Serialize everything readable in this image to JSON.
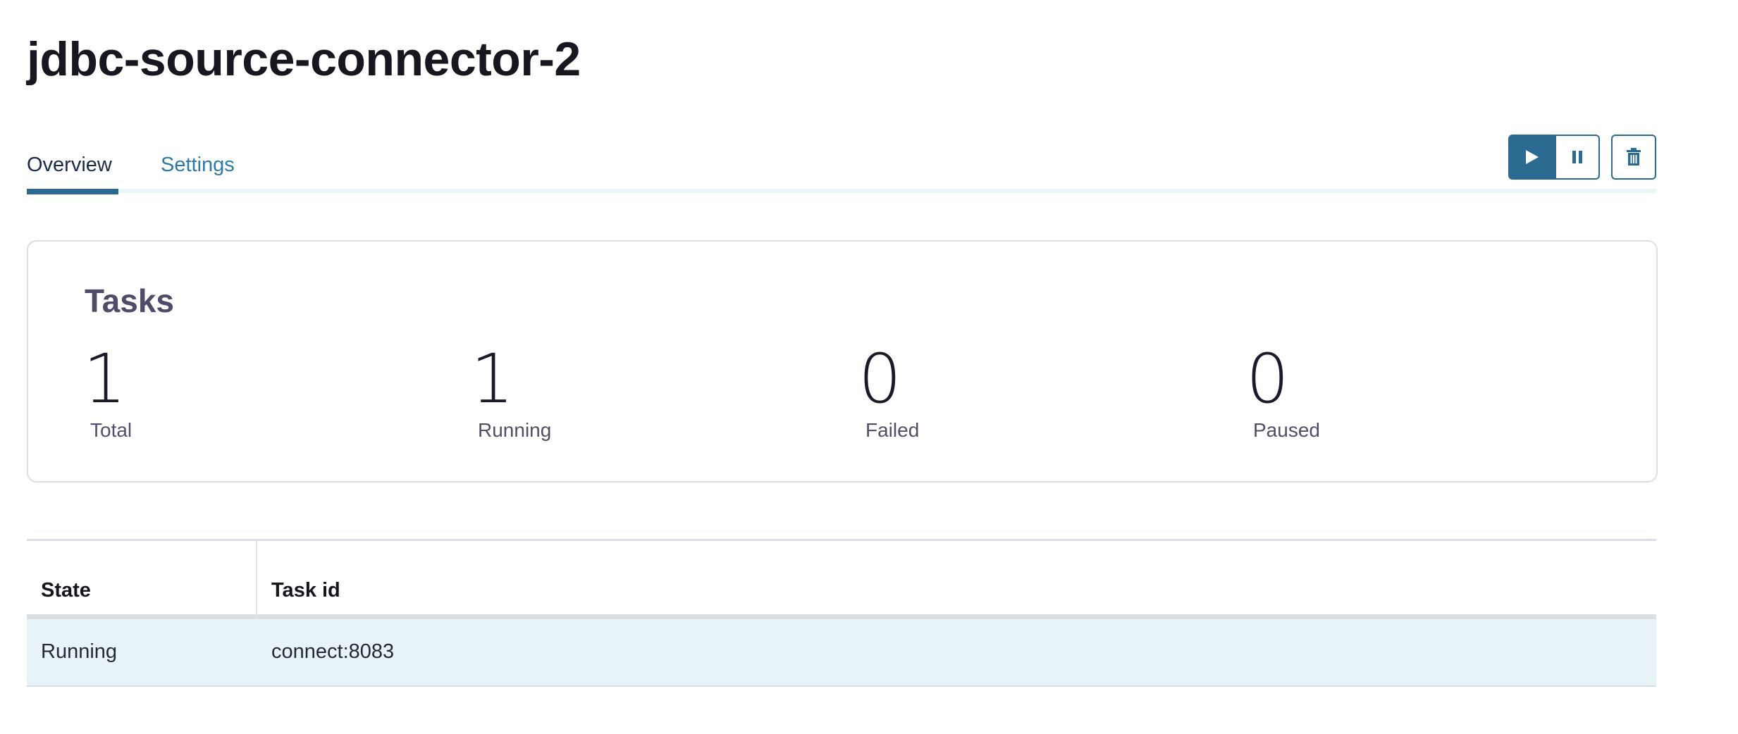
{
  "page": {
    "title": "jdbc-source-connector-2"
  },
  "tabs": [
    {
      "label": "Overview",
      "active": true
    },
    {
      "label": "Settings",
      "active": false
    }
  ],
  "actions": {
    "play_icon": "play-icon",
    "pause_icon": "pause-icon",
    "delete_icon": "trash-icon"
  },
  "tasks": {
    "title": "Tasks",
    "stats": [
      {
        "value": "1",
        "label": "Total"
      },
      {
        "value": "1",
        "label": "Running"
      },
      {
        "value": "0",
        "label": "Failed"
      },
      {
        "value": "0",
        "label": "Paused"
      }
    ]
  },
  "table": {
    "headers": [
      "State",
      "Task id"
    ],
    "rows": [
      [
        "Running",
        "connect:8083"
      ]
    ]
  },
  "colors": {
    "primary": "#2b6b92",
    "link": "#2e7aa3",
    "row_highlight": "#e8f3f8"
  }
}
